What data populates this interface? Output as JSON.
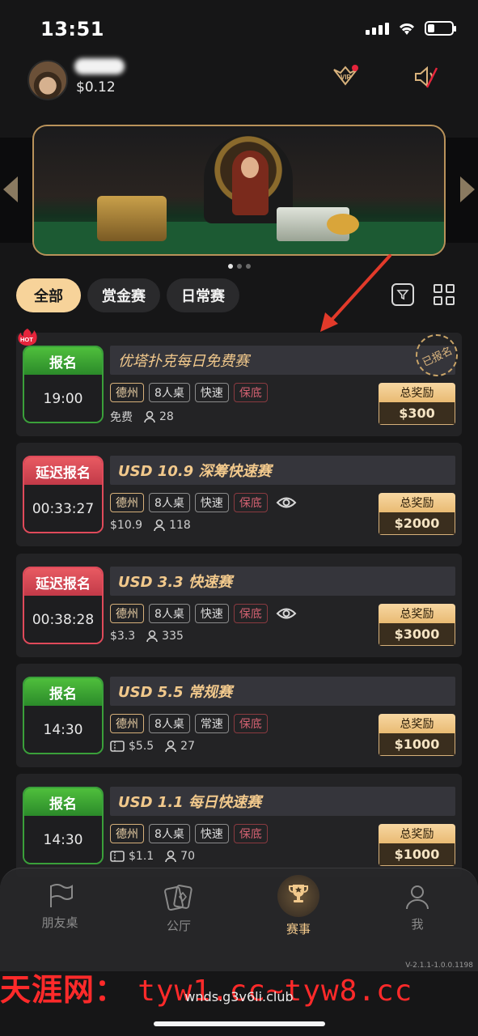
{
  "status_bar": {
    "time": "13:51"
  },
  "header": {
    "balance": "$0.12"
  },
  "banner": {
    "page_count": 3,
    "active_page": 1
  },
  "filters": {
    "tabs": [
      {
        "label": "全部",
        "active": true
      },
      {
        "label": "赏金赛",
        "active": false
      },
      {
        "label": "日常赛",
        "active": false
      }
    ]
  },
  "tournaments": [
    {
      "status": "报名",
      "status_color": "green",
      "time": "19:00",
      "title": "优塔扑克每日免费赛",
      "hot": true,
      "registered_label": "已报名",
      "tags": [
        "德州",
        "8人桌",
        "快速",
        "保底"
      ],
      "eye": false,
      "fee": "免费",
      "fee_ticket": false,
      "players": "28",
      "prize_label": "总奖励",
      "prize": "$300",
      "title_style": "regular"
    },
    {
      "status": "延迟报名",
      "status_color": "red",
      "time": "00:33:27",
      "title": "USD 10.9 深筹快速赛",
      "hot": false,
      "tags": [
        "德州",
        "8人桌",
        "快速",
        "保底"
      ],
      "eye": true,
      "fee": "$10.9",
      "fee_ticket": false,
      "players": "118",
      "prize_label": "总奖励",
      "prize": "$2000",
      "title_style": "bold"
    },
    {
      "status": "延迟报名",
      "status_color": "red",
      "time": "00:38:28",
      "title": "USD 3.3 快速赛",
      "hot": false,
      "tags": [
        "德州",
        "8人桌",
        "快速",
        "保底"
      ],
      "eye": true,
      "fee": "$3.3",
      "fee_ticket": false,
      "players": "335",
      "prize_label": "总奖励",
      "prize": "$3000",
      "title_style": "bold"
    },
    {
      "status": "报名",
      "status_color": "green",
      "time": "14:30",
      "title": "USD 5.5 常规赛",
      "hot": false,
      "tags": [
        "德州",
        "8人桌",
        "常速",
        "保底"
      ],
      "eye": false,
      "fee": "$5.5",
      "fee_ticket": true,
      "players": "27",
      "prize_label": "总奖励",
      "prize": "$1000",
      "title_style": "bold"
    },
    {
      "status": "报名",
      "status_color": "green",
      "time": "14:30",
      "title": "USD 1.1 每日快速赛",
      "hot": false,
      "tags": [
        "德州",
        "8人桌",
        "快速",
        "保底"
      ],
      "eye": false,
      "fee": "$1.1",
      "fee_ticket": true,
      "players": "70",
      "prize_label": "总奖励",
      "prize": "$1000",
      "title_style": "bold"
    }
  ],
  "bottom_nav": {
    "items": [
      {
        "label": "朋友桌",
        "icon": "flag-icon",
        "active": false
      },
      {
        "label": "公厅",
        "icon": "cards-icon",
        "active": false
      },
      {
        "label": "赛事",
        "icon": "trophy-icon",
        "active": true
      },
      {
        "label": "我",
        "icon": "person-icon",
        "active": false
      }
    ]
  },
  "version": "V-2.1.1-1.0.0.1198",
  "watermark": {
    "cn": "天涯网：",
    "domains": "tyw1.cc~tyw8.cc"
  },
  "url_bar": "wnds.g3v6li.club",
  "colors": {
    "accent_gold": "#f2c98c",
    "green": "#3aa03a",
    "red": "#e04a5a",
    "background": "#161617"
  }
}
